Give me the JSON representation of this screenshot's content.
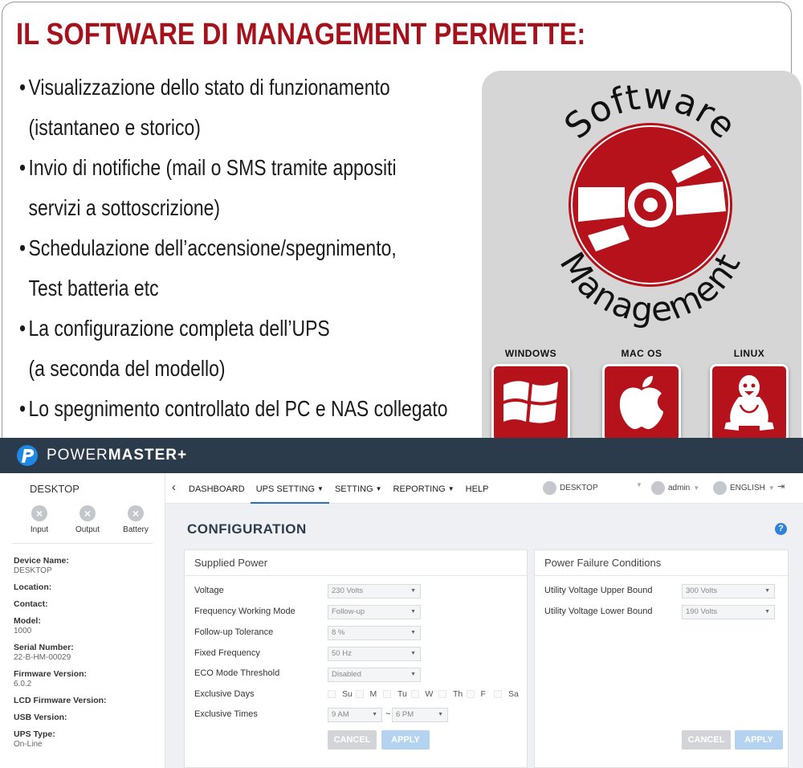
{
  "headline": "IL SOFTWARE DI MANAGEMENT PERMETTE:",
  "bullets": [
    "Visualizzazione dello stato di funzionamento",
    "(istantaneo e storico)",
    "Invio di notifiche (mail  o SMS tramite appositi",
    "servizi a sottoscrizione)",
    "Schedulazione dell’accensione/spegnimento,",
    "Test batteria etc",
    "La configurazione completa dell’UPS",
    "(a seconda del modello)",
    "Lo spegnimento controllato del PC e NAS collegato"
  ],
  "logo": {
    "word_top": "Software",
    "word_bottom": "Management"
  },
  "os": [
    {
      "label": "WINDOWS",
      "icon": "windows-icon"
    },
    {
      "label": "MAC OS",
      "icon": "apple-icon"
    },
    {
      "label": "LINUX",
      "icon": "tux-icon"
    }
  ],
  "colors": {
    "brand_red": "#b5121b",
    "appbar": "#2c3b4b",
    "accent_blue": "#2a6fbd"
  },
  "app": {
    "brand_light": "POWER",
    "brand_bold": "MASTER+"
  },
  "sidebar": {
    "title": "DESKTOP",
    "status": [
      {
        "label": "Input",
        "icon": "x-circle-icon"
      },
      {
        "label": "Output",
        "icon": "x-circle-icon"
      },
      {
        "label": "Battery",
        "icon": "x-circle-icon"
      }
    ],
    "info": [
      {
        "k": "Device Name:",
        "v": "DESKTOP"
      },
      {
        "k": "Location:",
        "v": ""
      },
      {
        "k": "Contact:",
        "v": ""
      },
      {
        "k": "Model:",
        "v": "1000"
      },
      {
        "k": "Serial Number:",
        "v": "22-B-HM-00029"
      },
      {
        "k": "Firmware Version:",
        "v": "6.0.2"
      },
      {
        "k": "LCD Firmware Version:",
        "v": ""
      },
      {
        "k": "USB Version:",
        "v": ""
      },
      {
        "k": "UPS Type:",
        "v": "On-Line"
      }
    ]
  },
  "nav": {
    "items": [
      "DASHBOARD",
      "UPS SETTING",
      "SETTING",
      "REPORTING",
      "HELP"
    ],
    "device": "DESKTOP",
    "user": "admin",
    "language": "ENGLISH"
  },
  "page": {
    "title": "CONFIGURATION"
  },
  "supplied": {
    "title": "Supplied Power",
    "fields": [
      {
        "label": "Voltage",
        "value": "230 Volts"
      },
      {
        "label": "Frequency Working Mode",
        "value": "Follow-up"
      },
      {
        "label": "Follow-up Tolerance",
        "value": "8 %"
      },
      {
        "label": "Fixed Frequency",
        "value": "50 Hz"
      },
      {
        "label": "ECO Mode Threshold",
        "value": "Disabled"
      }
    ],
    "days_label": "Exclusive Days",
    "days": [
      "Su",
      "M",
      "Tu",
      "W",
      "Th",
      "F",
      "Sa"
    ],
    "times_label": "Exclusive Times",
    "time_from": "9 AM",
    "time_sep": "~",
    "time_to": "6 PM",
    "cancel": "CANCEL",
    "apply": "APPLY"
  },
  "failure": {
    "title": "Power Failure Conditions",
    "fields": [
      {
        "label": "Utility Voltage Upper Bound",
        "value": "300 Volts"
      },
      {
        "label": "Utility Voltage Lower Bound",
        "value": "190 Volts"
      }
    ],
    "cancel": "CANCEL",
    "apply": "APPLY"
  }
}
